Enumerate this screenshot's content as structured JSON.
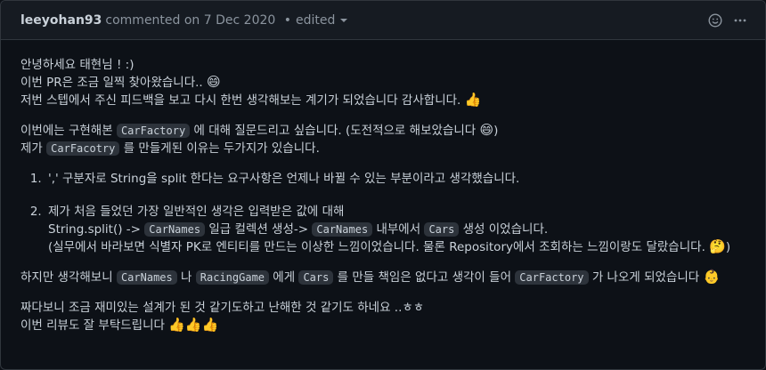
{
  "header": {
    "author": "leeyohan93",
    "action": "commented on",
    "date": "7 Dec 2020",
    "separator": "•",
    "edited": "edited"
  },
  "icons": [
    "smiley-icon",
    "kebab-menu-icon",
    "caret-down-icon"
  ],
  "emojis": {
    "grin": "😄",
    "thumbs_up": "👍",
    "thinking": "🤔",
    "baby": "👶",
    "thumbs_up_triple": "👍👍👍"
  },
  "body": {
    "p1_line1": "안녕하세요 태현님 ! :)",
    "p1_line2": "이번 PR은 조금 일찍 찾아왔습니다.. ",
    "p1_line3": "저번 스텝에서 주신 피드백을 보고 다시 한번 생각해보는 계기가 되었습니다 감사합니다. ",
    "p2_l1_a": "이번에는 구현해본 ",
    "p2_l1_code": "CarFactory",
    "p2_l1_b": " 에 대해 질문드리고 싶습니다. (도전적으로 해보았습니다 ",
    "p2_l1_c": ")",
    "p2_l2_a": "제가 ",
    "p2_l2_code": "CarFacotry",
    "p2_l2_b": " 를 만들게된 이유는 두가지가 있습니다.",
    "li1": "',' 구분자로 String을 split 한다는 요구사항은 언제나 바뀔 수 있는 부분이라고 생각했습니다.",
    "li2_l1": "제가 처음 들었던 가장 일반적인 생각은 입력받은 값에 대해",
    "li2_l2_a": "String.split() -> ",
    "li2_l2_code1": "CarNames",
    "li2_l2_b": " 일급 컬렉션 생성-> ",
    "li2_l2_code2": "CarNames",
    "li2_l2_c": " 내부에서 ",
    "li2_l2_code3": "Cars",
    "li2_l2_d": " 생성 이었습니다.",
    "li2_l3": "(실무에서 바라보면 식별자 PK로 엔티티를 만드는 이상한 느낌이었습니다. 물론 Repository에서 조회하는 느낌이랑도 달랐습니다. ",
    "li2_l3_end": ")",
    "p3_a": "하지만 생각해보니 ",
    "p3_code1": "CarNames",
    "p3_b": " 나 ",
    "p3_code2": "RacingGame",
    "p3_c": " 에게 ",
    "p3_code3": "Cars",
    "p3_d": " 를 만들 책임은 없다고 생각이 들어 ",
    "p3_code4": "CarFactory",
    "p3_e": " 가 나오게 되었습니다 ",
    "p4_line1": "짜다보니 조금 재미있는 설계가 된 것 같기도하고 난해한 것 같기도 하네요 ..ㅎㅎ",
    "p4_line2": "이번 리뷰도 잘 부탁드립니다 "
  }
}
